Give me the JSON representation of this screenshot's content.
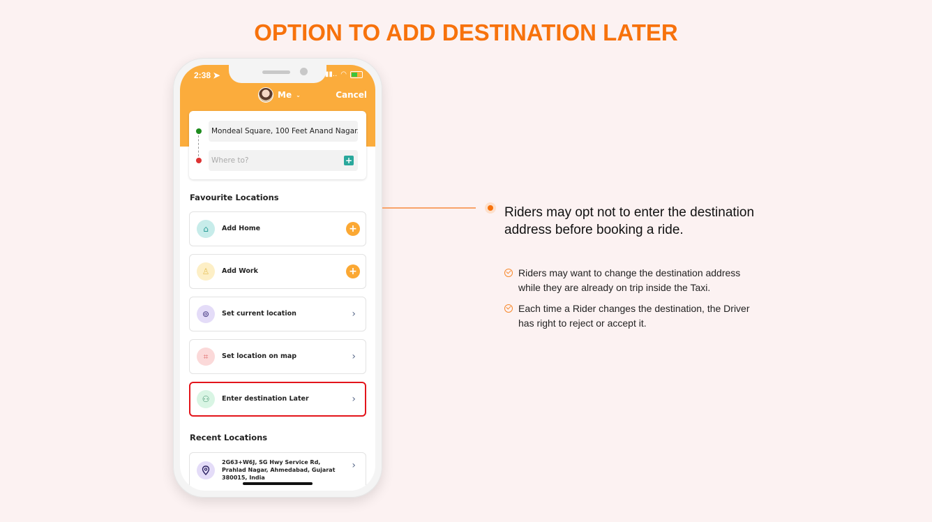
{
  "page": {
    "title": "OPTION TO ADD DESTINATION LATER"
  },
  "phone": {
    "status_bar": {
      "time": "2:38",
      "signal": "▪▪..",
      "wifi": "wifi",
      "battery": "charging"
    },
    "header": {
      "profile_label": "Me",
      "cancel_label": "Cancel"
    },
    "route": {
      "pickup_value": "Mondeal Square, 100 Feet Anand Nagar...",
      "destination_placeholder": "Where to?"
    },
    "favourite_title": "Favourite Locations",
    "favourites": [
      {
        "label": "Add Home",
        "icon": "home-icon",
        "action": "add",
        "color": "#c7ecea"
      },
      {
        "label": "Add Work",
        "icon": "work-icon",
        "action": "add",
        "color": "#fdefc6"
      },
      {
        "label": "Set current location",
        "icon": "current-location-icon",
        "action": "chevron",
        "color": "#e4dcf8"
      },
      {
        "label": "Set location on map",
        "icon": "map-icon",
        "action": "chevron",
        "color": "#fbd9d9"
      },
      {
        "label": "Enter destination Later",
        "icon": "destination-later-icon",
        "action": "chevron",
        "color": "#d9f5e4"
      }
    ],
    "recent_title": "Recent Locations",
    "recent": [
      {
        "address": "2G63+W6J, SG Hwy Service Rd, Prahlad Nagar, Ahmedabad, Gujarat 380015, India"
      }
    ]
  },
  "annotation": {
    "heading": "Riders may opt not to enter the destination address before booking a ride.",
    "bullets": [
      "Riders may want to change the destination address while they are already on trip inside the Taxi.",
      "Each time a Rider changes the destination, the Driver has right to reject or accept it."
    ]
  },
  "colors": {
    "accent": "#f7720c",
    "header": "#fbac3c",
    "highlight": "#e3141b"
  }
}
